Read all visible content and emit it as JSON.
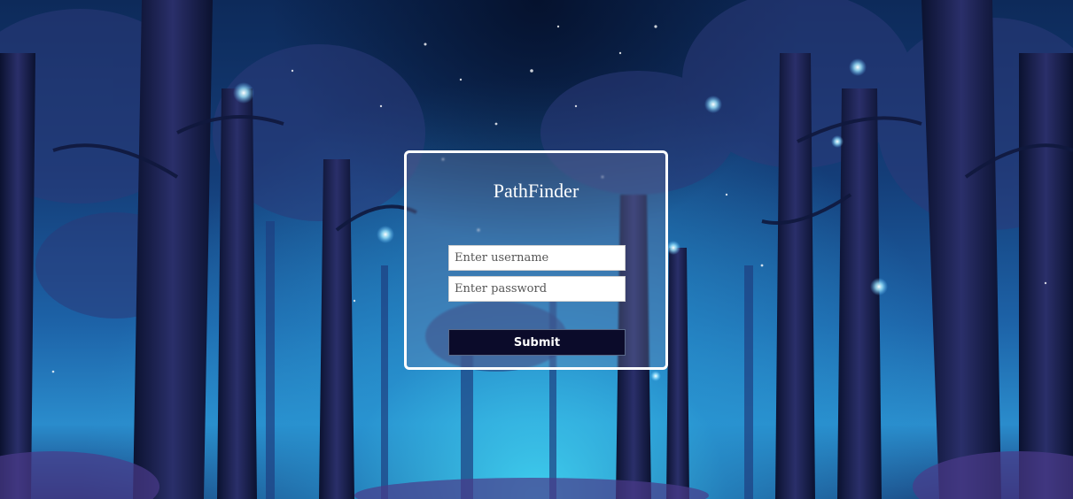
{
  "app": {
    "title": "PathFinder"
  },
  "login": {
    "username_placeholder": "Enter username",
    "username_value": "",
    "password_placeholder": "Enter password",
    "password_value": "",
    "submit_label": "Submit"
  },
  "colors": {
    "card_border": "#ffffff",
    "button_bg": "#0b0b2a",
    "title_color": "#ffffff"
  }
}
